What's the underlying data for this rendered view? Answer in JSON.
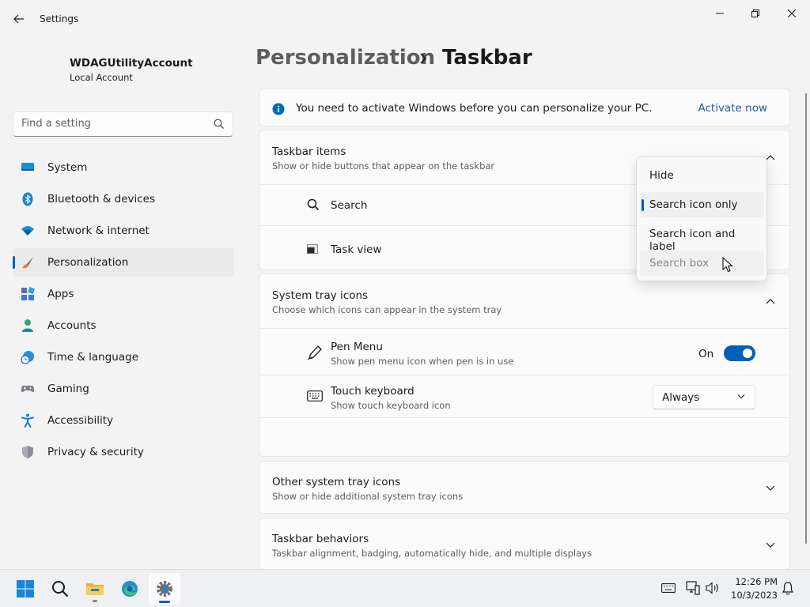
{
  "window": {
    "title": "Settings"
  },
  "account": {
    "name": "WDAGUtilityAccount",
    "type": "Local Account"
  },
  "search": {
    "placeholder": "Find a setting"
  },
  "sidebar": {
    "items": [
      {
        "label": "System",
        "icon": "system-icon"
      },
      {
        "label": "Bluetooth & devices",
        "icon": "bluetooth-icon"
      },
      {
        "label": "Network & internet",
        "icon": "wifi-icon"
      },
      {
        "label": "Personalization",
        "icon": "brush-icon",
        "active": true
      },
      {
        "label": "Apps",
        "icon": "apps-icon"
      },
      {
        "label": "Accounts",
        "icon": "person-icon"
      },
      {
        "label": "Time & language",
        "icon": "globe-clock-icon"
      },
      {
        "label": "Gaming",
        "icon": "controller-icon"
      },
      {
        "label": "Accessibility",
        "icon": "accessibility-icon"
      },
      {
        "label": "Privacy & security",
        "icon": "shield-icon"
      }
    ]
  },
  "header": {
    "parent": "Personalization",
    "current": "Taskbar"
  },
  "activation": {
    "message": "You need to activate Windows before you can personalize your PC.",
    "link": "Activate now"
  },
  "taskbar_items": {
    "title": "Taskbar items",
    "subtitle": "Show or hide buttons that appear on the taskbar",
    "rows": [
      {
        "label": "Search",
        "icon": "search-icon"
      },
      {
        "label": "Task view",
        "icon": "task-view-icon"
      }
    ],
    "search_options": [
      {
        "label": "Hide"
      },
      {
        "label": "Search icon only",
        "selected": true
      },
      {
        "label": "Search icon and label"
      },
      {
        "label": "Search box",
        "disabled": true
      }
    ]
  },
  "system_tray": {
    "title": "System tray icons",
    "subtitle": "Choose which icons can appear in the system tray",
    "pen_menu": {
      "title": "Pen Menu",
      "subtitle": "Show pen menu icon when pen is in use",
      "state_label": "On",
      "on": true
    },
    "touch_keyboard": {
      "title": "Touch keyboard",
      "subtitle": "Show touch keyboard icon",
      "value": "Always"
    }
  },
  "other_tray": {
    "title": "Other system tray icons",
    "subtitle": "Show or hide additional system tray icons"
  },
  "behaviors": {
    "title": "Taskbar behaviors",
    "subtitle": "Taskbar alignment, badging, automatically hide, and multiple displays"
  },
  "taskbar": {
    "clock": {
      "time": "12:26 PM",
      "date": "10/3/2023"
    }
  },
  "colors": {
    "accent": "#005fb8",
    "link": "#1a5ea6",
    "info": "#0067c0"
  }
}
